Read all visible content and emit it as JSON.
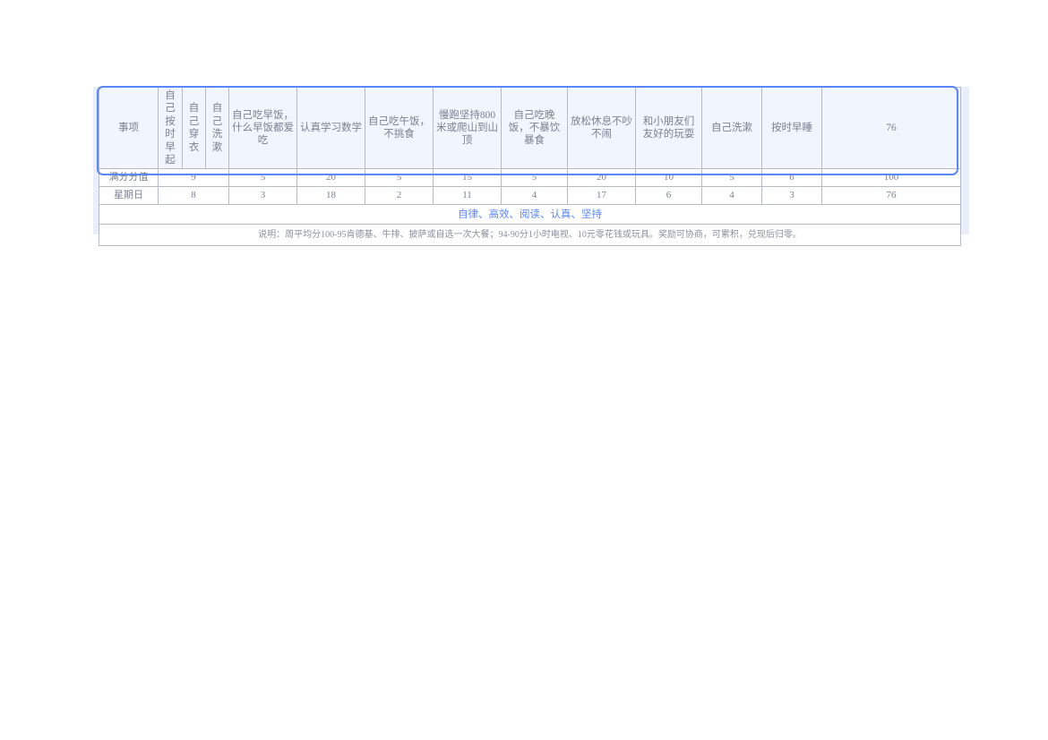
{
  "sheet": {
    "accent_color": "#5b86f7",
    "header_bg": "#f1f5fd",
    "selection_bg": "#e8eefb",
    "grid_line": "#b7bcc4",
    "text_color": "#7a8190"
  },
  "table": {
    "headers": [
      "事项",
      "自己按时早起",
      "自己穿衣",
      "自己洗漱",
      "自己吃早饭，什么早饭都爱吃",
      "认真学习数学",
      "自己吃午饭，不挑食",
      "慢跑坚持800米或爬山到山顶",
      "自己吃晚饭，不暴饮暴食",
      "放松休息不吵不闹",
      "和小朋友们友好的玩耍",
      "自己洗漱",
      "按时早睡",
      "76"
    ],
    "rows": [
      {
        "label": "满分分值",
        "values": [
          "9",
          "5",
          "20",
          "5",
          "15",
          "5",
          "20",
          "10",
          "5",
          "6",
          "100"
        ]
      },
      {
        "label": "星期日",
        "values": [
          "8",
          "3",
          "18",
          "2",
          "11",
          "4",
          "17",
          "6",
          "4",
          "3",
          "76"
        ]
      }
    ],
    "slogan": "自律、高效、阅读、认真、坚持",
    "note": "说明：周平均分100-95肯德基、牛排、披萨或自选一次大餐；94-90分1小时电视、10元零花钱或玩具。奖励可协商，可累积，兑现后归零。"
  }
}
